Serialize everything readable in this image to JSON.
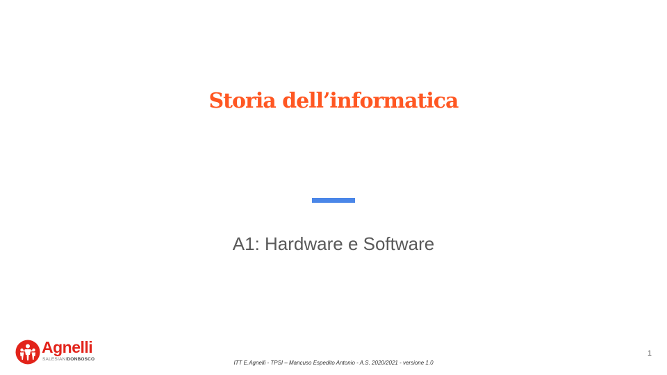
{
  "slide": {
    "title": "Storia dell’informatica",
    "subtitle": "A1: Hardware e Software",
    "footer": "ITT E.Agnelli  -  TPSI – Mancuso  Espedito  Antonio  - A.S. 2020/2021  - versione 1.0",
    "page_number": "1"
  },
  "logo": {
    "name": "Agnelli",
    "tag_light": "SALESIANI",
    "tag_bold": "DONBOSCO"
  },
  "colors": {
    "title": "#ff5722",
    "divider": "#4a86e8",
    "subtitle": "#595959",
    "logo": "#e2231a"
  }
}
